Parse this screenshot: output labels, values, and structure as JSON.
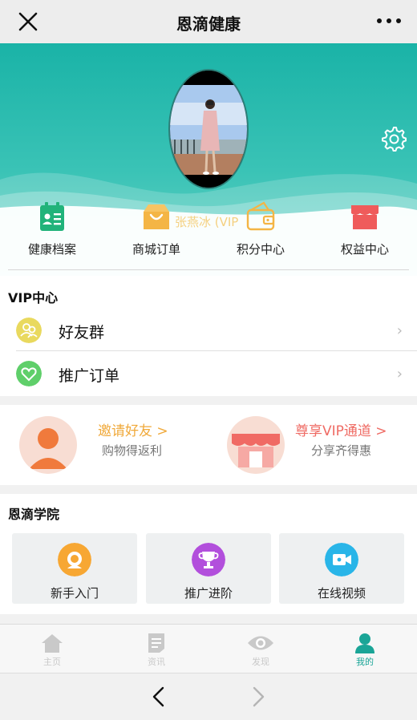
{
  "titlebar": {
    "title": "恩滴健康"
  },
  "profile": {
    "username": "张燕冰 (VIP"
  },
  "quick_actions": [
    {
      "label": "健康档案",
      "icon": "health-record-icon",
      "color": "#21b37a"
    },
    {
      "label": "商城订单",
      "icon": "shop-order-icon",
      "color": "#f4b545"
    },
    {
      "label": "积分中心",
      "icon": "wallet-icon",
      "color": "#f4b545"
    },
    {
      "label": "权益中心",
      "icon": "store-icon",
      "color": "#ef5b5b"
    }
  ],
  "vip": {
    "title": "VIP中心",
    "items": [
      {
        "label": "好友群",
        "icon": "friends-icon",
        "chevron": "›"
      },
      {
        "label": "推广订单",
        "icon": "heart-icon",
        "chevron": "›"
      }
    ]
  },
  "promo": {
    "invite": {
      "title": "邀请好友 >",
      "subtitle": "购物得返利",
      "color": "#f0a93a"
    },
    "vip_channel": {
      "title": "尊享VIP通道 >",
      "subtitle": "分享齐得惠",
      "color": "#ef6b64"
    }
  },
  "academy": {
    "title": "恩滴学院",
    "cards": [
      {
        "label": "新手入门",
        "icon": "newbie-icon",
        "color": "#f7a733"
      },
      {
        "label": "推广进阶",
        "icon": "trophy-icon",
        "color": "#b24fdc"
      },
      {
        "label": "在线视频",
        "icon": "video-icon",
        "color": "#29b5e8"
      }
    ]
  },
  "tabbar": {
    "tabs": [
      {
        "label": "主页",
        "active": false
      },
      {
        "label": "资讯",
        "active": false
      },
      {
        "label": "发现",
        "active": false
      },
      {
        "label": "我的",
        "active": true
      }
    ],
    "active_color": "#1aa597"
  },
  "colors": {
    "accent": "#1ab3a7",
    "header_gradient_end": "#6bd3c6"
  }
}
